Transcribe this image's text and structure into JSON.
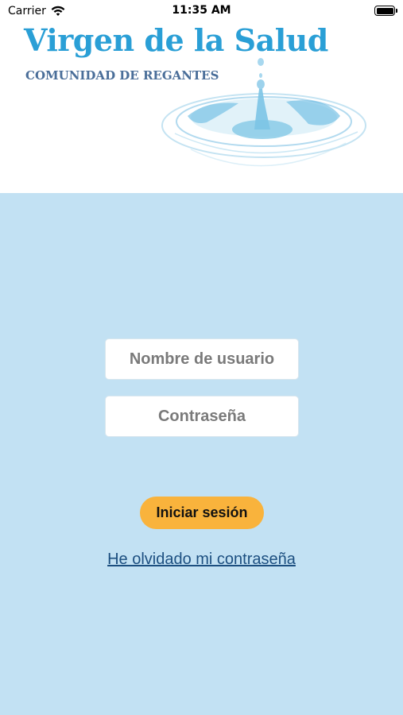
{
  "status_bar": {
    "carrier": "Carrier",
    "time": "11:35 AM",
    "wifi_icon": "wifi-icon",
    "battery_icon": "battery-icon"
  },
  "brand": {
    "title": "Virgen de la Salud",
    "subtitle": "COMUNIDAD DE REGANTES",
    "logo_icon": "water-drop-icon"
  },
  "login": {
    "username_placeholder": "Nombre de usuario",
    "username_value": "",
    "password_placeholder": "Contraseña",
    "password_value": "",
    "submit_label": "Iniciar sesión",
    "forgot_password_label": "He olvidado mi contraseña"
  },
  "colors": {
    "brand_blue": "#2a9fd6",
    "subtitle_blue": "#4a6e99",
    "background": "#c2e1f3",
    "button": "#f9b33c",
    "link": "#1c4f80"
  }
}
